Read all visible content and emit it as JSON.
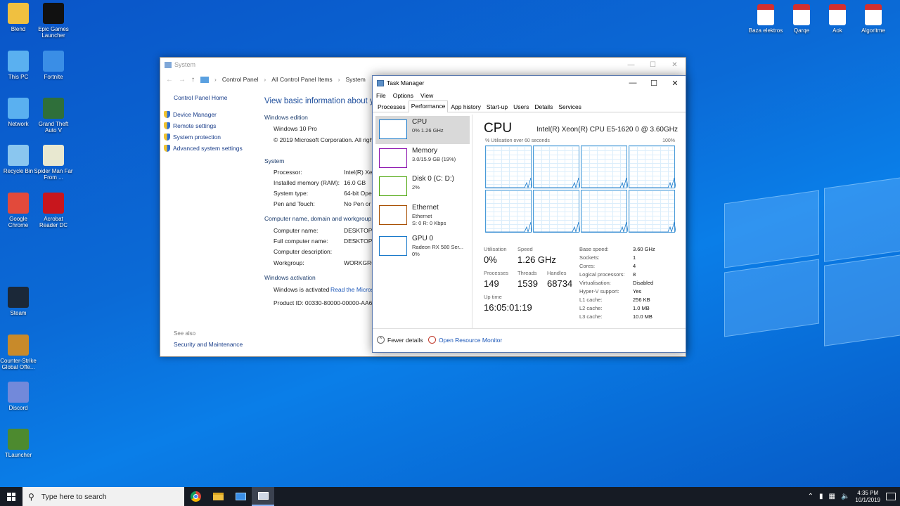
{
  "desktop_icons_left": [
    {
      "label": "Blend",
      "icon": "folder-person-icon",
      "color": "#f0c040"
    },
    {
      "label": "Epic Games Launcher",
      "icon": "epic-games-icon",
      "color": "#111111"
    },
    {
      "label": "This PC",
      "icon": "computer-icon",
      "color": "#5ab0f0"
    },
    {
      "label": "Fortnite",
      "icon": "fortnite-icon",
      "color": "#3a8ee6"
    },
    {
      "label": "Network",
      "icon": "network-icon",
      "color": "#5ab0f0"
    },
    {
      "label": "Grand Theft Auto V",
      "icon": "gta-icon",
      "color": "#2f6f3a"
    },
    {
      "label": "Recycle Bin",
      "icon": "recycle-bin-icon",
      "color": "#8ac6ef"
    },
    {
      "label": "Spider Man Far From ...",
      "icon": "spiderman-icon",
      "color": "#e8e8d0"
    },
    {
      "label": "Google Chrome",
      "icon": "chrome-icon",
      "color": "#e24a3b"
    },
    {
      "label": "Acrobat Reader DC",
      "icon": "acrobat-icon",
      "color": "#c8161d"
    },
    {
      "label": "Steam",
      "icon": "steam-icon",
      "color": "#1b2838"
    },
    {
      "label": "Counter-Strike Global Offe...",
      "icon": "csgo-icon",
      "color": "#c88a2a"
    },
    {
      "label": "Discord",
      "icon": "discord-icon",
      "color": "#7289da"
    },
    {
      "label": "TLauncher",
      "icon": "tlauncher-icon",
      "color": "#4d8a2f"
    }
  ],
  "desktop_icons_right": [
    {
      "label": "Baza elektros",
      "icon": "pdf-file-icon"
    },
    {
      "label": "Qarqe",
      "icon": "pdf-file-icon"
    },
    {
      "label": "Aok",
      "icon": "pdf-file-icon"
    },
    {
      "label": "Algoritme",
      "icon": "pdf-file-icon"
    }
  ],
  "system_window": {
    "title": "System",
    "breadcrumb": [
      "Control Panel",
      "All Control Panel Items",
      "System"
    ],
    "nav": {
      "home": "Control Panel Home",
      "items": [
        "Device Manager",
        "Remote settings",
        "System protection",
        "Advanced system settings"
      ],
      "see_also": "See also",
      "security": "Security and Maintenance"
    },
    "heading": "View basic information about you",
    "edition_title": "Windows edition",
    "edition": "Windows 10 Pro",
    "copyright": "© 2019 Microsoft Corporation. All rights",
    "system_title": "System",
    "system_rows": [
      {
        "label": "Processor:",
        "value": "Intel(R) Xeon"
      },
      {
        "label": "Installed memory (RAM):",
        "value": "16.0 GB"
      },
      {
        "label": "System type:",
        "value": "64-bit Oper"
      },
      {
        "label": "Pen and Touch:",
        "value": "No Pen or T"
      }
    ],
    "computer_title": "Computer name, domain and workgroup se",
    "computer_rows": [
      {
        "label": "Computer name:",
        "value": "DESKTOP-N"
      },
      {
        "label": "Full computer name:",
        "value": "DESKTOP-N"
      },
      {
        "label": "Computer description:",
        "value": ""
      },
      {
        "label": "Workgroup:",
        "value": "WORKGROU"
      }
    ],
    "activation_title": "Windows activation",
    "activation_status": "Windows is activated",
    "activation_link": "Read the Microso",
    "product_id": "Product ID: 00330-80000-00000-AA641"
  },
  "task_manager": {
    "title": "Task Manager",
    "menu": [
      "File",
      "Options",
      "View"
    ],
    "tabs": [
      "Processes",
      "Performance",
      "App history",
      "Start-up",
      "Users",
      "Details",
      "Services"
    ],
    "active_tab": "Performance",
    "resources": [
      {
        "name": "CPU",
        "sub1": "0% 1.26 GHz",
        "sub2": "",
        "color": "#1979ca",
        "selected": true
      },
      {
        "name": "Memory",
        "sub1": "3.0/15.9 GB (19%)",
        "sub2": "",
        "color": "#8b12ae",
        "selected": false
      },
      {
        "name": "Disk 0 (C: D:)",
        "sub1": "2%",
        "sub2": "",
        "color": "#4da60c",
        "selected": false
      },
      {
        "name": "Ethernet",
        "sub1": "Ethernet",
        "sub2": "S: 0 R: 0 Kbps",
        "color": "#a74f01",
        "selected": false
      },
      {
        "name": "GPU 0",
        "sub1": "Radeon RX 580 Ser...",
        "sub2": "0%",
        "color": "#1979ca",
        "selected": false
      }
    ],
    "cpu": {
      "heading": "CPU",
      "model": "Intel(R) Xeon(R) CPU E5-1620 0 @ 3.60GHz",
      "util_label": "% Utilisation over 60 seconds",
      "util_max": "100%",
      "stats": {
        "utilisation_label": "Utilisation",
        "utilisation": "0%",
        "speed_label": "Speed",
        "speed": "1.26 GHz",
        "processes_label": "Processes",
        "processes": "149",
        "threads_label": "Threads",
        "threads": "1539",
        "handles_label": "Handles",
        "handles": "68734",
        "uptime_label": "Up time",
        "uptime": "16:05:01:19"
      },
      "specs": [
        {
          "label": "Base speed:",
          "value": "3.60 GHz"
        },
        {
          "label": "Sockets:",
          "value": "1"
        },
        {
          "label": "Cores:",
          "value": "4"
        },
        {
          "label": "Logical processors:",
          "value": "8"
        },
        {
          "label": "Virtualisation:",
          "value": "Disabled"
        },
        {
          "label": "Hyper-V support:",
          "value": "Yes"
        },
        {
          "label": "L1 cache:",
          "value": "256 KB"
        },
        {
          "label": "L2 cache:",
          "value": "1.0 MB"
        },
        {
          "label": "L3 cache:",
          "value": "10.0 MB"
        }
      ]
    },
    "footer": {
      "fewer": "Fewer details",
      "resmon": "Open Resource Monitor"
    }
  },
  "taskbar": {
    "search_placeholder": "Type here to search",
    "time": "4:35 PM",
    "date": "10/1/2019",
    "pinned": [
      "chrome-icon",
      "file-explorer-icon",
      "control-panel-icon",
      "task-manager-icon"
    ]
  }
}
